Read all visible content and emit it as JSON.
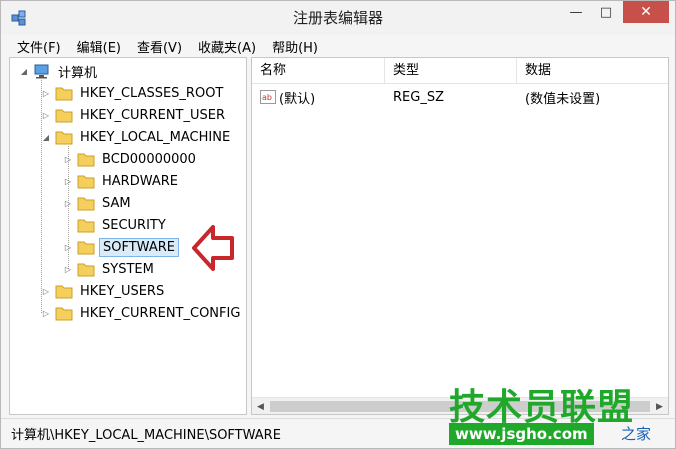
{
  "window": {
    "title": "注册表编辑器"
  },
  "title_buttons": {
    "minimize": "—",
    "maximize": "□",
    "close": "✕"
  },
  "menu": [
    {
      "label": "文件(F)"
    },
    {
      "label": "编辑(E)"
    },
    {
      "label": "查看(V)"
    },
    {
      "label": "收藏夹(A)"
    },
    {
      "label": "帮助(H)"
    }
  ],
  "tree": {
    "root": "计算机",
    "hives": {
      "classes_root": "HKEY_CLASSES_ROOT",
      "current_user": "HKEY_CURRENT_USER",
      "local_machine": "HKEY_LOCAL_MACHINE",
      "users": "HKEY_USERS",
      "current_config": "HKEY_CURRENT_CONFIG"
    },
    "local_machine_children": {
      "bcd": "BCD00000000",
      "hardware": "HARDWARE",
      "sam": "SAM",
      "security": "SECURITY",
      "software": "SOFTWARE",
      "system": "SYSTEM"
    },
    "selected": "SOFTWARE"
  },
  "list": {
    "columns": {
      "name": "名称",
      "type": "类型",
      "data": "数据"
    },
    "rows": [
      {
        "name": "(默认)",
        "type": "REG_SZ",
        "data": "(数值未设置)"
      }
    ]
  },
  "status_bar": {
    "path": "计算机\\HKEY_LOCAL_MACHINE\\SOFTWARE"
  },
  "watermark": {
    "brand": "技术员联盟",
    "url": "www.jsgho.com",
    "site": "之家"
  },
  "colors": {
    "annotation_arrow": "#c8282d",
    "watermark_green": "#1fa82a",
    "close_button": "#c7504a",
    "selection": "#d9ebf9"
  }
}
